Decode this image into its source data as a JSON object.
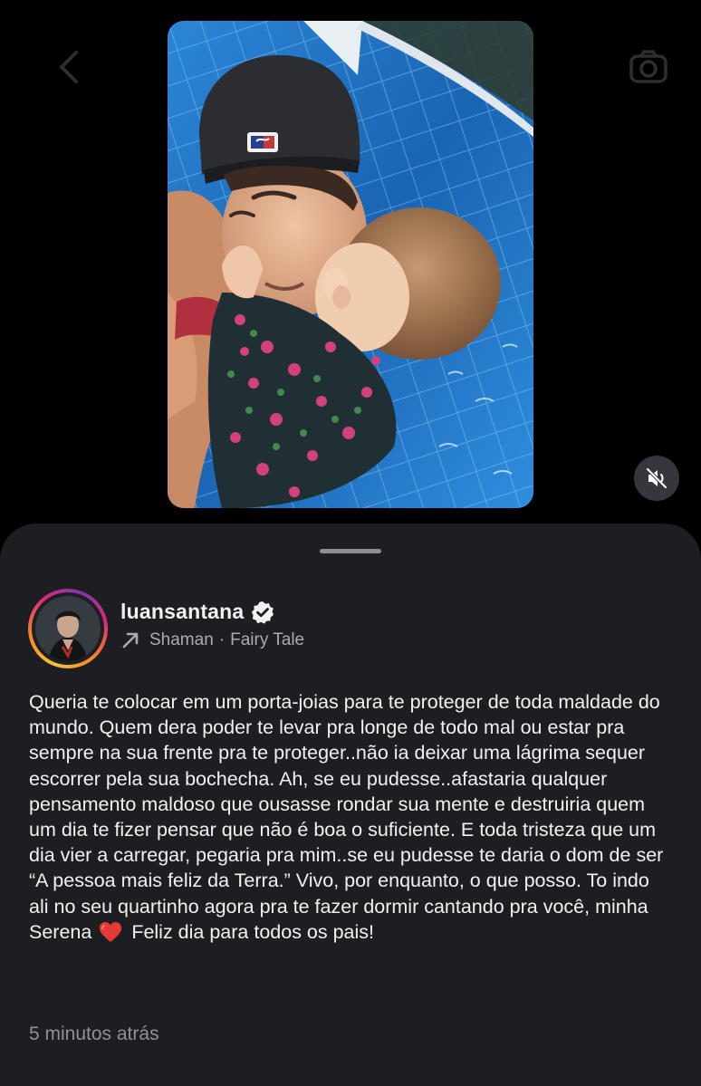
{
  "post": {
    "username": "luansantana",
    "verified": true,
    "music": {
      "artist": "Shaman",
      "separator": "·",
      "track": "Fairy Tale"
    },
    "caption_part1": "Queria te colocar em um porta-joias para te proteger de toda maldade do mundo. Quem dera poder te levar pra longe de todo mal ou estar pra sempre na sua frente pra te proteger..não ia deixar uma lágrima sequer escorrer pela sua bochecha. Ah, se eu pudesse..afastaria qualquer pensamento maldoso que ousasse rondar sua mente e destruiria quem um dia te fizer pensar que não é boa o suficiente. E toda tristeza que um dia vier a carregar, pegaria pra mim..se eu pudesse te daria o dom de ser “A pessoa mais feliz da Terra.” Vivo, por enquanto, o que posso. To indo ali no seu quartinho agora pra te fazer dormir cantando pra você, minha Serena",
    "caption_emoji": "heart-icon",
    "caption_part2": "Feliz dia para todos os pais!",
    "timestamp": "5 minutos atrás"
  },
  "icons": {
    "back": "chevron-left-icon",
    "camera": "camera-icon",
    "mute": "speaker-muted-icon",
    "verified": "verified-badge-icon",
    "music": "arrow-up-right-icon"
  },
  "colors": {
    "sheet_background": "#1c1e21",
    "text_primary": "#f1f1f1",
    "text_secondary": "#a9acb1",
    "heart": "#e53935",
    "story_ring": [
      "#f9c33b",
      "#dd2a7b",
      "#8134af"
    ]
  }
}
